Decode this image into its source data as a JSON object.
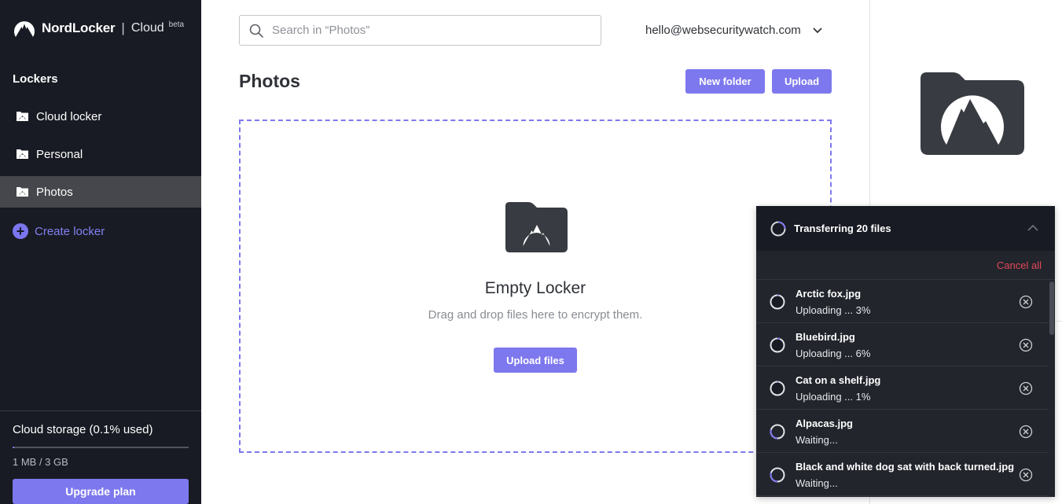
{
  "brand": {
    "name": "NordLocker",
    "separator": "|",
    "product": "Cloud",
    "badge": "beta"
  },
  "sidebar": {
    "heading": "Lockers",
    "items": [
      {
        "label": "Cloud locker",
        "icon": "locker-icon",
        "active": false
      },
      {
        "label": "Personal",
        "icon": "locker-icon",
        "active": false
      },
      {
        "label": "Photos",
        "icon": "locker-icon",
        "active": true
      }
    ],
    "create_label": "Create locker",
    "storage": {
      "title": "Cloud storage (0.1% used)",
      "used_fraction": 0.001,
      "usage": "1 MB / 3 GB",
      "upgrade_label": "Upgrade plan"
    }
  },
  "header": {
    "search_placeholder": "Search in “Photos”",
    "search_value": "",
    "account_email": "hello@websecuritywatch.com"
  },
  "main": {
    "title": "Photos",
    "new_folder_label": "New folder",
    "upload_label": "Upload",
    "empty": {
      "title": "Empty Locker",
      "subtitle": "Drag and drop files here to encrypt them.",
      "button_label": "Upload files"
    }
  },
  "transfer": {
    "title": "Transferring 20 files",
    "cancel_all_label": "Cancel all",
    "files": [
      {
        "name": "Arctic fox.jpg",
        "status": "Uploading ... 3%",
        "progress": 0.03
      },
      {
        "name": "Bluebird.jpg",
        "status": "Uploading ... 6%",
        "progress": 0.06
      },
      {
        "name": "Cat on a shelf.jpg",
        "status": "Uploading ... 1%",
        "progress": 0.01
      },
      {
        "name": "Alpacas.jpg",
        "status": "Waiting...",
        "progress": 0
      },
      {
        "name": "Black and white dog sat with back turned.jpg",
        "status": "Waiting...",
        "progress": 0
      }
    ]
  },
  "colors": {
    "accent": "#7d78ee",
    "sidebar_bg": "#181b23",
    "active_item": "#45474c",
    "danger": "#e2475a",
    "icon_dark": "#383b41"
  }
}
